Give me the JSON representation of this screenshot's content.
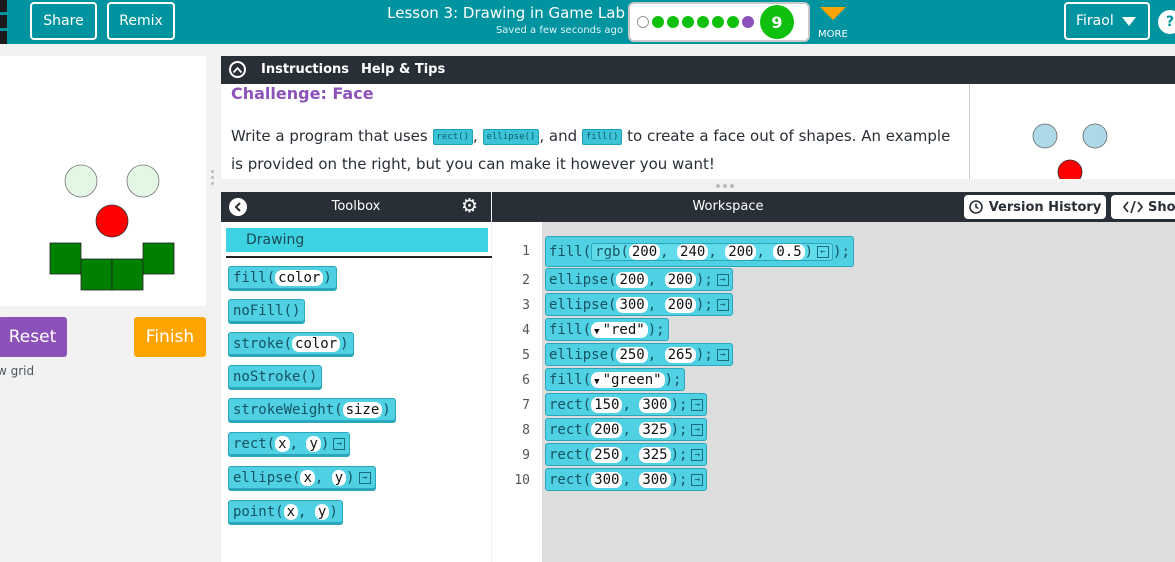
{
  "header": {
    "share": "Share",
    "remix": "Remix",
    "lesson_title": "Lesson 3: Drawing in Game Lab",
    "saved_status": "Saved a few seconds ago",
    "level_number": "9",
    "more": "MORE",
    "user_name": "Firaol",
    "help": "?"
  },
  "viz": {
    "reset": "Reset",
    "finish": "Finish",
    "grid_label": "w grid"
  },
  "instructions": {
    "tab_instructions": "Instructions",
    "tab_help": "Help & Tips",
    "challenge_title": "Challenge: Face",
    "text_1": "Write a program that uses ",
    "code_rect": "rect()",
    "sep_1": ", ",
    "code_ellipse": "ellipse()",
    "sep_2": ", and ",
    "code_fill": "fill()",
    "text_2": " to create a face out of shapes. An example is provided on the right, but you can make it however you want!"
  },
  "toolbox": {
    "title": "Toolbox",
    "category": "Drawing",
    "blocks": [
      {
        "name": "fill",
        "params": [
          "color"
        ],
        "ret": false
      },
      {
        "name": "noFill",
        "params": [],
        "ret": false
      },
      {
        "name": "stroke",
        "params": [
          "color"
        ],
        "ret": false
      },
      {
        "name": "noStroke",
        "params": [],
        "ret": false
      },
      {
        "name": "strokeWeight",
        "params": [
          "size"
        ],
        "ret": false
      },
      {
        "name": "rect",
        "params": [
          "x",
          "y"
        ],
        "ret": true
      },
      {
        "name": "ellipse",
        "params": [
          "x",
          "y"
        ],
        "ret": true
      },
      {
        "name": "point",
        "params": [
          "x",
          "y"
        ],
        "ret": false
      }
    ]
  },
  "workspace": {
    "title": "Workspace",
    "version_history": "Version History",
    "show_code": "Sho",
    "lines": [
      {
        "num": "1",
        "func": "fill",
        "rgb": [
          "200",
          "240",
          "200",
          "0.5"
        ]
      },
      {
        "num": "2",
        "func": "ellipse",
        "args": [
          "200",
          "200"
        ],
        "ret": true
      },
      {
        "num": "3",
        "func": "ellipse",
        "args": [
          "300",
          "200"
        ],
        "ret": true
      },
      {
        "num": "4",
        "func": "fill",
        "color": "\"red\""
      },
      {
        "num": "5",
        "func": "ellipse",
        "args": [
          "250",
          "265"
        ],
        "ret": true
      },
      {
        "num": "6",
        "func": "fill",
        "color": "\"green\""
      },
      {
        "num": "7",
        "func": "rect",
        "args": [
          "150",
          "300"
        ],
        "ret": true
      },
      {
        "num": "8",
        "func": "rect",
        "args": [
          "200",
          "325"
        ],
        "ret": true
      },
      {
        "num": "9",
        "func": "rect",
        "args": [
          "250",
          "325"
        ],
        "ret": true
      },
      {
        "num": "10",
        "func": "rect",
        "args": [
          "300",
          "300"
        ],
        "ret": true
      }
    ]
  },
  "colors": {
    "brand_teal": "#0094a0",
    "dark_header": "#292f36",
    "block_cyan": "#4fd0e3",
    "purple": "#8c52ba",
    "orange": "#ffa400",
    "level_green": "#0fc00f"
  }
}
